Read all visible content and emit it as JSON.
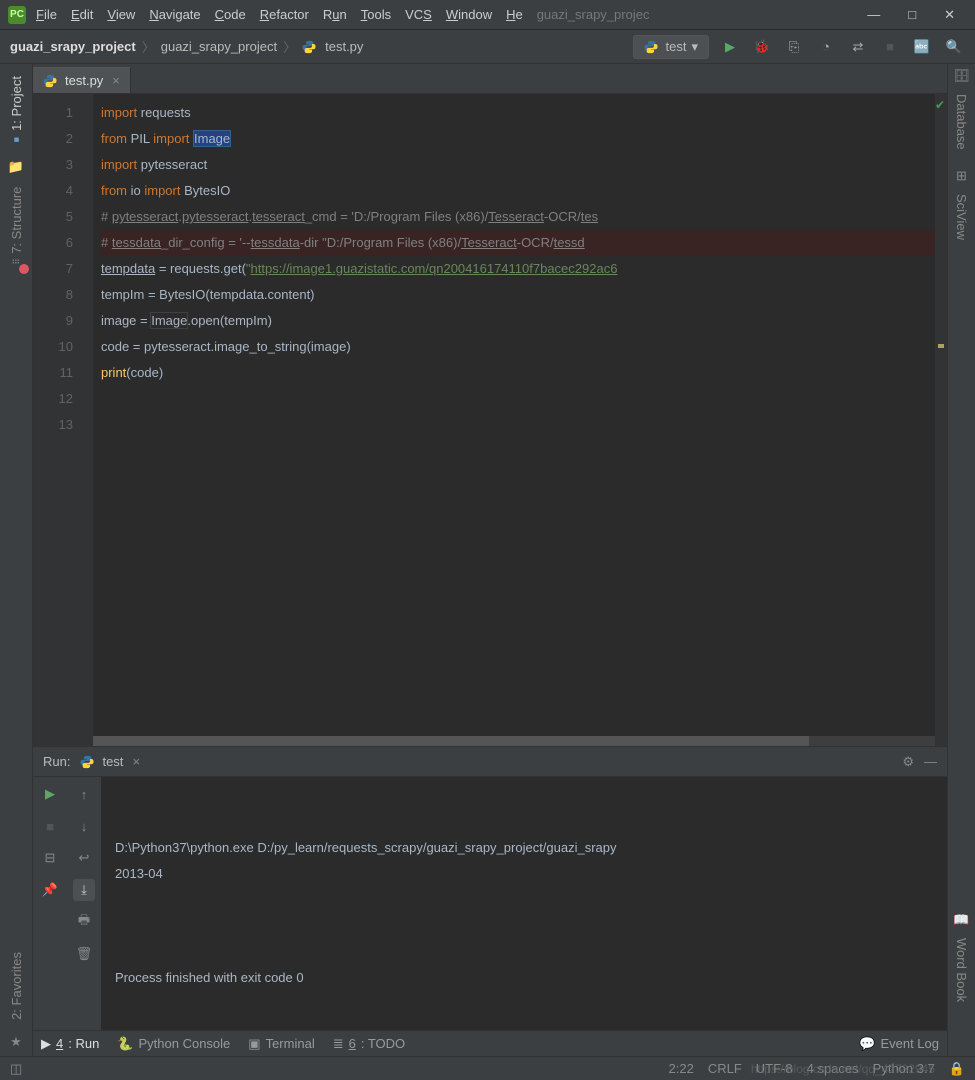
{
  "menu": [
    "File",
    "Edit",
    "View",
    "Navigate",
    "Code",
    "Refactor",
    "Run",
    "Tools",
    "VCS",
    "Window",
    "Help"
  ],
  "title_project": "guazi_srapy_projec",
  "breadcrumb": {
    "b1": "guazi_srapy_project",
    "b2": "guazi_srapy_project",
    "b3": "test.py"
  },
  "run_config": "test",
  "tab": {
    "name": "test.py"
  },
  "left_tabs": {
    "project": "1: Project",
    "structure": "7: Structure",
    "favorites": "2: Favorites"
  },
  "right_tabs": {
    "database": "Database",
    "sciview": "SciView",
    "wordbook": "Word Book"
  },
  "code_lines": [
    {
      "n": "1",
      "segs": [
        {
          "t": "import ",
          "c": "kw"
        },
        {
          "t": "requests"
        }
      ]
    },
    {
      "n": "2",
      "segs": [
        {
          "t": "from ",
          "c": "kw"
        },
        {
          "t": "PIL "
        },
        {
          "t": "import ",
          "c": "kw"
        },
        {
          "t": "Image",
          "c": "sel"
        }
      ]
    },
    {
      "n": "3",
      "segs": [
        {
          "t": "import ",
          "c": "kw"
        },
        {
          "t": "pytesseract"
        }
      ]
    },
    {
      "n": "4",
      "segs": [
        {
          "t": "from ",
          "c": "kw"
        },
        {
          "t": "io "
        },
        {
          "t": "import ",
          "c": "kw"
        },
        {
          "t": "BytesIO"
        }
      ]
    },
    {
      "n": "5",
      "segs": [
        {
          "t": ""
        }
      ]
    },
    {
      "n": "6",
      "segs": [
        {
          "t": "# ",
          "c": "cm"
        },
        {
          "t": "pytesseract",
          "c": "um"
        },
        {
          "t": ".",
          "c": "cm"
        },
        {
          "t": "pytesseract",
          "c": "um"
        },
        {
          "t": ".",
          "c": "cm"
        },
        {
          "t": "tesseract",
          "c": "um"
        },
        {
          "t": "_cmd = 'D:/Program Files (x86)/",
          "c": "cm"
        },
        {
          "t": "Tesseract",
          "c": "um"
        },
        {
          "t": "-OCR/",
          "c": "cm"
        },
        {
          "t": "tes",
          "c": "um"
        }
      ]
    },
    {
      "n": "7",
      "bp": true,
      "segs": [
        {
          "t": "# ",
          "c": "cm"
        },
        {
          "t": "tessdata",
          "c": "um"
        },
        {
          "t": "_dir_config = '--",
          "c": "cm"
        },
        {
          "t": "tessdata",
          "c": "um"
        },
        {
          "t": "-dir \"D:/Program Files (x86)/",
          "c": "cm"
        },
        {
          "t": "Tesseract",
          "c": "um"
        },
        {
          "t": "-OCR/",
          "c": "cm"
        },
        {
          "t": "tessd",
          "c": "um"
        }
      ]
    },
    {
      "n": "8",
      "segs": [
        {
          "t": "tempdata",
          "c": "um-w"
        },
        {
          "t": " = requests.get("
        },
        {
          "t": "\"",
          "c": "str"
        },
        {
          "t": "https://image1.guazistatic.com/qn200416174110f7bacec292ac6",
          "c": "url"
        }
      ]
    },
    {
      "n": "9",
      "segs": [
        {
          "t": "tempIm = BytesIO(tempdata.content)"
        }
      ]
    },
    {
      "n": "10",
      "segs": [
        {
          "t": "image = "
        },
        {
          "t": "Image",
          "c": "hl"
        },
        {
          "t": ".open(tempIm)"
        }
      ]
    },
    {
      "n": "11",
      "segs": [
        {
          "t": "code = pytesseract.image_to_string(image)"
        }
      ]
    },
    {
      "n": "12",
      "segs": [
        {
          "t": "print",
          "c": "fn"
        },
        {
          "t": "(code)"
        }
      ]
    },
    {
      "n": "13",
      "segs": [
        {
          "t": ""
        }
      ]
    }
  ],
  "run": {
    "title": "Run:",
    "tab": "test",
    "output": [
      "D:\\Python37\\python.exe D:/py_learn/requests_scrapy/guazi_srapy_project/guazi_srapy",
      "2013-04",
      "",
      "",
      "",
      "Process finished with exit code 0"
    ]
  },
  "bottom": {
    "run": "4: Run",
    "console": "Python Console",
    "terminal": "Terminal",
    "todo": "6: TODO",
    "eventlog": "Event Log"
  },
  "status": {
    "pos": "2:22",
    "lineend": "CRLF",
    "encoding": "UTF-8",
    "indent": "4 spaces",
    "python": "Python 3.7"
  },
  "watermark": "https://blog.csdn.net/qq_42782945"
}
